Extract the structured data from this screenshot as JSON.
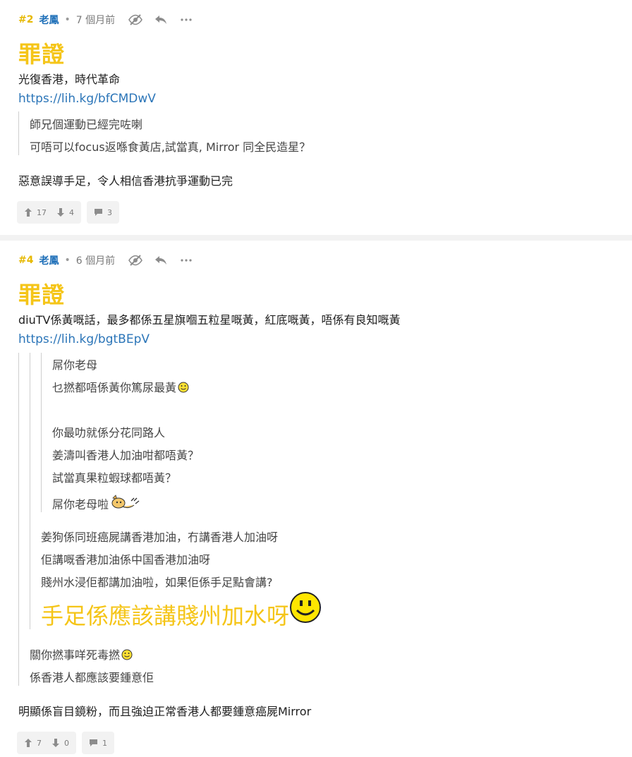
{
  "posts": [
    {
      "floor": "#2",
      "author": "老鳳",
      "time": "7 個月前",
      "title": "罪證",
      "body": [
        "光復香港，時代革命"
      ],
      "link": "https://lih.kg/bfCMDwV",
      "quote": [
        "師兄個運動已經完咗喇",
        "可唔可以focus返喺食黃店,試當真, Mirror 同全民造星？"
      ],
      "comment": "惡意誤導手足，令人相信香港抗爭運動已完",
      "upvotes": "17",
      "downvotes": "4",
      "replies": "3"
    },
    {
      "floor": "#4",
      "author": "老鳳",
      "time": "6 個月前",
      "title": "罪證",
      "body": [
        "diuTV係黃嘅話，最多都係五星旗嗰五粒星嘅黃，紅底嘅黃，唔係有良知嘅黃"
      ],
      "link": "https://lih.kg/bgtBEpV",
      "quote_level3": [
        "屌你老母",
        "乜撚都唔係黃你篤尿最黃",
        "你最叻就係分花同路人",
        "姜濤叫香港人加油咁都唔黃？",
        "試當真果粒蝦球都唔黃？",
        "屌你老母啦"
      ],
      "quote_level2": [
        "姜狗係同班癌屍講香港加油，冇講香港人加油呀",
        "佢講嘅香港加油係中国香港加油呀",
        "賤州水浸佢都講加油啦，如果佢係手足點會講?",
        "手足係應該講賤州加水呀"
      ],
      "quote_level1": [
        "關你撚事咩死毒撚",
        "係香港人都應該要鍾意佢"
      ],
      "comment": "明顯係盲目鏡粉，而且強迫正常香港人都要鍾意癌屍Mirror",
      "upvotes": "7",
      "downvotes": "0",
      "replies": "1"
    }
  ],
  "icons": {
    "hide": "eye-slash-icon",
    "reply": "reply-icon",
    "more": "more-icon",
    "up": "thumb-up-icon",
    "down": "thumb-down-icon",
    "comment": "comment-icon"
  },
  "colors": {
    "floor": "#e6b800",
    "author": "#1e6fb8",
    "title": "#f5c518",
    "link": "#2b75b8"
  }
}
